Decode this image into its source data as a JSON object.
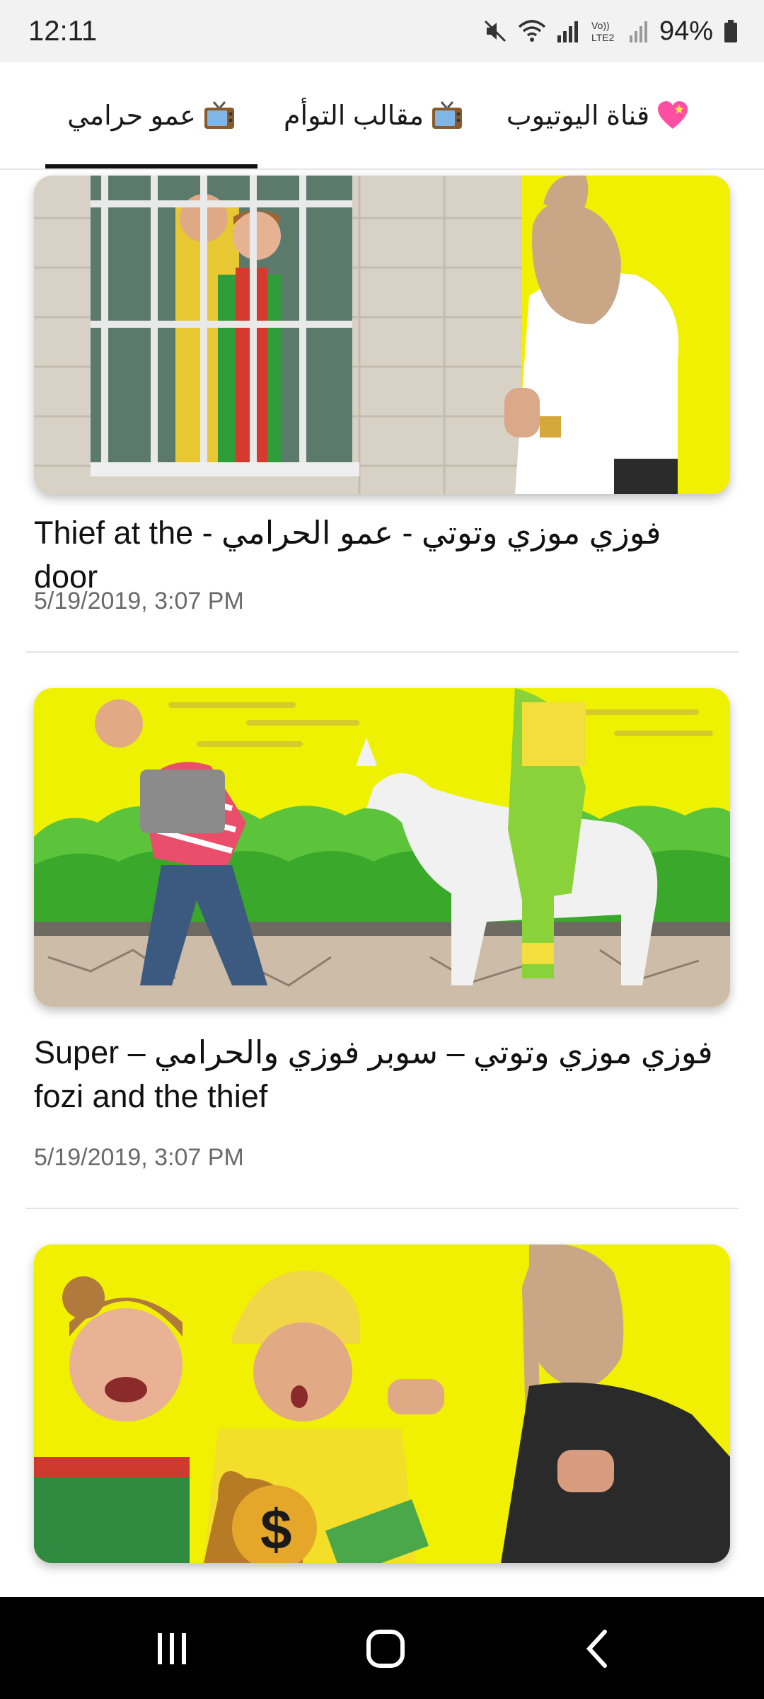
{
  "status_bar": {
    "time": "12:11",
    "battery": "94%",
    "icons": [
      "mute-icon",
      "wifi-icon",
      "signal-r-icon",
      "volte-icon",
      "signal-icon",
      "battery-icon"
    ],
    "volte_label": "Vo)) LTE2"
  },
  "tabs": [
    {
      "label": "قناة اليوتيوب",
      "icon": "heart-icon",
      "selected": false
    },
    {
      "label": "مقالب التوأم",
      "icon": "tv-icon",
      "selected": false
    },
    {
      "label": "عمو حرامي",
      "icon": "tv-icon",
      "selected": true
    }
  ],
  "videos": [
    {
      "title": "فوزي موزي وتوتي - عمو الحرامي - Thief at the door",
      "date": "5/19/2019, 3:07 PM"
    },
    {
      "title": "فوزي موزي وتوتي – سوبر فوزي والحرامي – Super fozi and the thief",
      "date": "5/19/2019, 3:07 PM"
    },
    {
      "title": "",
      "date": ""
    }
  ],
  "nav": {
    "recents": "recents-icon",
    "home": "home-icon",
    "back": "back-icon"
  },
  "colors": {
    "thumb_yellow": "#f0f000",
    "tab_indicator": "#111111",
    "nav_background": "#000000"
  }
}
